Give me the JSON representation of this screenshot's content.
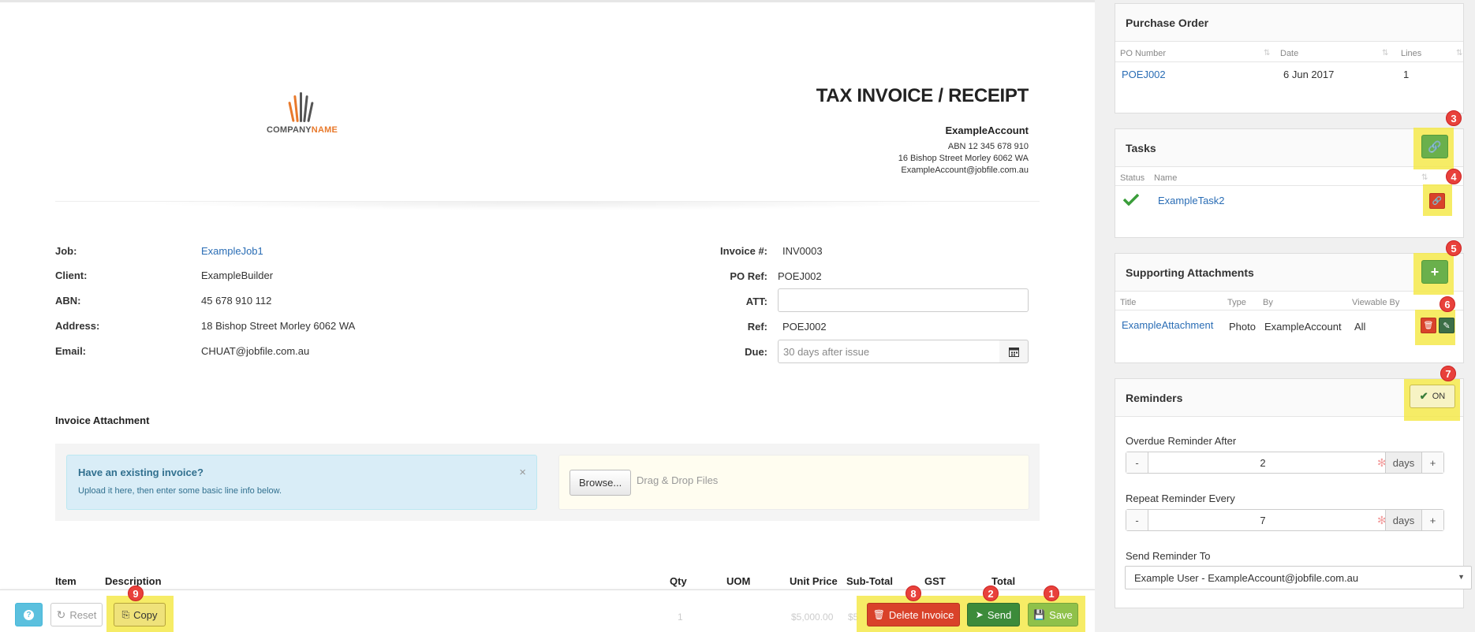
{
  "invoice": {
    "company": {
      "name_part1": "COMPANY",
      "name_part2": "NAME"
    },
    "title": "TAX INVOICE / RECEIPT",
    "account_name": "ExampleAccount",
    "abn_line": "ABN 12 345 678 910",
    "address_line": "16 Bishop Street Morley 6062 WA",
    "email_line": "ExampleAccount@jobfile.com.au",
    "fields": {
      "job_label": "Job:",
      "job_value": "ExampleJob1",
      "client_label": "Client:",
      "client_value": "ExampleBuilder",
      "abn_label": "ABN:",
      "abn_value": "45 678 910 112",
      "address_label": "Address:",
      "address_value": "18 Bishop Street Morley 6062 WA",
      "email_label": "Email:",
      "email_value": "CHUAT@jobfile.com.au",
      "invoice_no_label": "Invoice #:",
      "invoice_no_value": "INV0003",
      "po_ref_label": "PO Ref:",
      "po_ref_value": "POEJ002",
      "att_label": "ATT:",
      "att_value": "",
      "ref_label": "Ref:",
      "ref_value": "POEJ002",
      "due_label": "Due:",
      "due_placeholder": "30 days after issue"
    },
    "attachment": {
      "section_title": "Invoice Attachment",
      "alert_title": "Have an existing invoice?",
      "alert_text": "Upload it here, then enter some basic line info below.",
      "close_glyph": "×",
      "browse_label": "Browse...",
      "drop_text": "Drag & Drop Files"
    },
    "table_headers": [
      "Item",
      "Description",
      "Qty",
      "UOM",
      "Unit Price",
      "Sub-Total",
      "GST",
      "Total"
    ],
    "faded_row": {
      "qty": "1",
      "unit_price": "$5,000.00",
      "sub_total": "$5"
    }
  },
  "footer": {
    "help_icon": "question-icon",
    "reset_label": "Reset",
    "copy_label": "Copy",
    "delete_label": "Delete Invoice",
    "send_label": "Send",
    "save_label": "Save",
    "badges": {
      "save": "1",
      "send": "2",
      "delete": "8",
      "copy": "9"
    }
  },
  "sidebar": {
    "purchase_order": {
      "title": "Purchase Order",
      "columns": [
        "PO Number",
        "Date",
        "Lines"
      ],
      "row": {
        "po_number": "POEJ002",
        "date": "6 Jun 2017",
        "lines": "1"
      }
    },
    "tasks": {
      "title": "Tasks",
      "columns": [
        "Status",
        "Name"
      ],
      "row": {
        "name": "ExampleTask2"
      },
      "badges": {
        "link": "3",
        "unlink": "4"
      }
    },
    "attachments": {
      "title": "Supporting Attachments",
      "columns": [
        "Title",
        "Type",
        "By",
        "Viewable By"
      ],
      "row": {
        "title": "ExampleAttachment",
        "type": "Photo",
        "by": "ExampleAccount",
        "viewable_by": "All"
      },
      "badges": {
        "add": "5",
        "row_actions": "6"
      }
    },
    "reminders": {
      "title": "Reminders",
      "toggle_label": "ON",
      "badge": "7",
      "overdue_label": "Overdue Reminder After",
      "overdue_value": "2",
      "repeat_label": "Repeat Reminder Every",
      "repeat_value": "7",
      "unit": "days",
      "minus": "-",
      "plus": "+",
      "send_to_label": "Send Reminder To",
      "send_to_value": "Example User - ExampleAccount@jobfile.com.au"
    }
  },
  "colors": {
    "link": "#2a6db5",
    "highlight": "#f4e94b",
    "badge": "#e8413b",
    "save_green": "#8fc14a",
    "send_green": "#3c8b3a",
    "delete_red": "#d9422a",
    "help_blue": "#5bc0de"
  }
}
